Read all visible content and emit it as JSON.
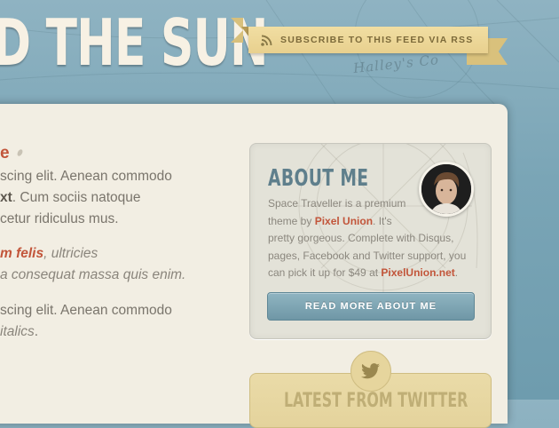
{
  "header": {
    "site_title": "D THE SUN",
    "map_label": "Halley's Co"
  },
  "subscribe": {
    "label": "SUBSCRIBE TO THIS FEED VIA RSS",
    "icon": "rss-icon"
  },
  "post": {
    "title": "e",
    "paragraphs": [
      {
        "text": "scing elit. Aenean commodo"
      },
      {
        "bold": "xt",
        "rest": ". Cum sociis natoque"
      },
      {
        "text": "cetur ridiculus mus."
      },
      {
        "accent": "m felis",
        "italic": ", ultricies"
      },
      {
        "italic_line": "a consequat massa quis enim."
      },
      {
        "text": "scing elit. Aenean commodo"
      },
      {
        "italic_line": "italics",
        "rest": "."
      }
    ]
  },
  "about": {
    "title": "ABOUT ME",
    "text_1": "Space Traveller is a premium",
    "text_2_pre": "theme by ",
    "text_2_link": "Pixel Union",
    "text_2_post": ". It's",
    "text_3": "pretty gorgeous. Complete with Disqus,",
    "text_4": "pages, Facebook and Twitter support, you",
    "text_5_pre": "can pick it up for $49 at ",
    "text_5_link": "PixelUnion.net",
    "text_5_post": ".",
    "button_label": "READ MORE ABOUT ME",
    "avatar_icon": "avatar"
  },
  "twitter": {
    "title": "LATEST FROM TWITTER",
    "icon": "twitter-bird-icon"
  },
  "colors": {
    "sky": "#7aa5b6",
    "paper": "#f2eee3",
    "accent": "#c2553a",
    "ribbon": "#e8d08e",
    "button": "#7fa4b2"
  }
}
